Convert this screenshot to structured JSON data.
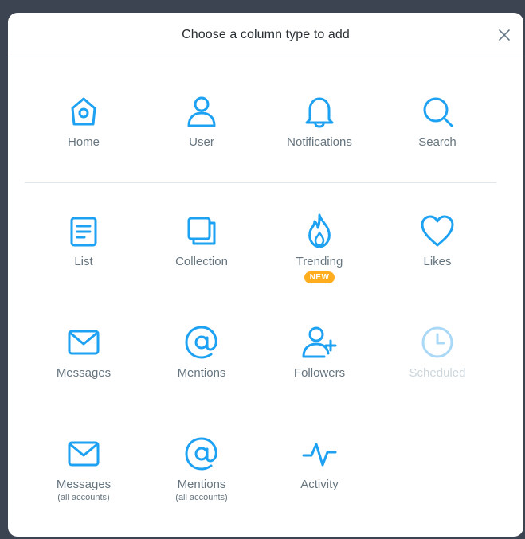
{
  "modal": {
    "title": "Choose a column type to add"
  },
  "colors": {
    "accent": "#1da1f2",
    "disabled": "#aad8f7",
    "badge": "#ffad1f"
  },
  "tiles": {
    "home": {
      "label": "Home",
      "icon": "home-icon"
    },
    "user": {
      "label": "User",
      "icon": "user-icon"
    },
    "notifications": {
      "label": "Notifications",
      "icon": "bell-icon"
    },
    "search": {
      "label": "Search",
      "icon": "search-icon"
    },
    "list": {
      "label": "List",
      "icon": "list-icon"
    },
    "collection": {
      "label": "Collection",
      "icon": "collection-icon"
    },
    "trending": {
      "label": "Trending",
      "icon": "flame-icon",
      "badge": "NEW"
    },
    "likes": {
      "label": "Likes",
      "icon": "heart-icon"
    },
    "messages": {
      "label": "Messages",
      "icon": "envelope-icon"
    },
    "mentions": {
      "label": "Mentions",
      "icon": "at-icon"
    },
    "followers": {
      "label": "Followers",
      "icon": "add-user-icon"
    },
    "scheduled": {
      "label": "Scheduled",
      "icon": "clock-icon",
      "disabled": true
    },
    "messages_all": {
      "label": "Messages",
      "sublabel": "(all accounts)",
      "icon": "envelope-icon"
    },
    "mentions_all": {
      "label": "Mentions",
      "sublabel": "(all accounts)",
      "icon": "at-icon"
    },
    "activity": {
      "label": "Activity",
      "icon": "activity-icon"
    }
  }
}
